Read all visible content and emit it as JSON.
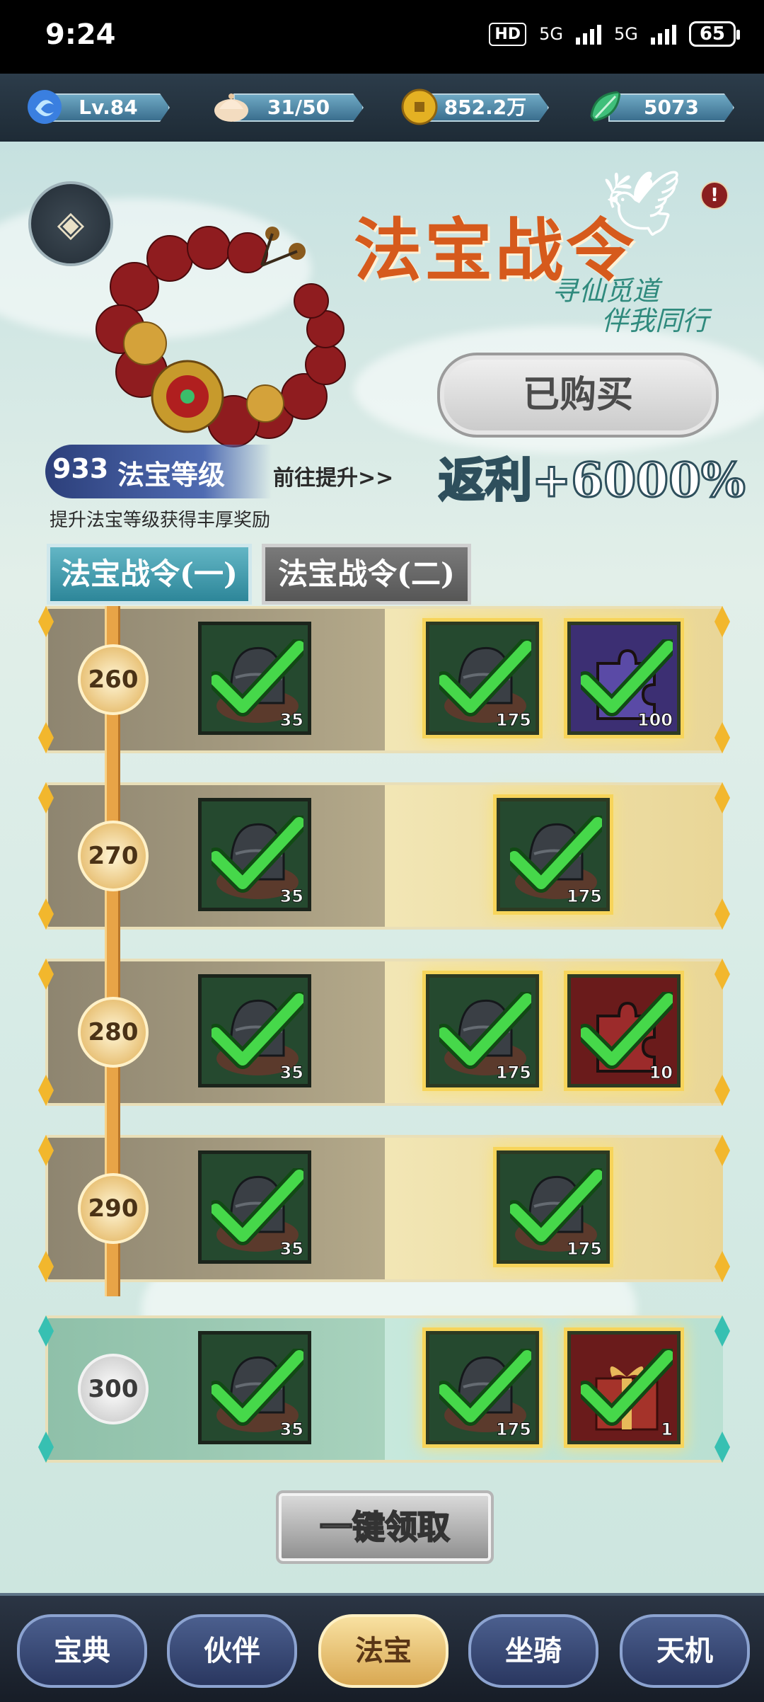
{
  "status": {
    "time": "9:24",
    "hd_label": "HD",
    "net1": "5G",
    "net2": "5G",
    "battery": "65"
  },
  "resources": {
    "level": "Lv.84",
    "stamina": "31/50",
    "coins": "852.2万",
    "jade": "5073"
  },
  "header": {
    "title": "法宝战令",
    "subtitle_line1": "寻仙觅道",
    "subtitle_line2": "伴我同行",
    "alert_icon_text": "!",
    "bought_label": "已购买",
    "rebate": "返利+6000%"
  },
  "treasure": {
    "level_num": "933",
    "level_label": "法宝等级",
    "goto_label": "前往提升>>",
    "hint": "提升法宝等级获得丰厚奖励"
  },
  "tabs": [
    {
      "label": "法宝战令(一)",
      "active": true
    },
    {
      "label": "法宝战令(二)",
      "active": false
    }
  ],
  "rows": [
    {
      "level": "260",
      "free": {
        "qty": "35"
      },
      "paid": [
        {
          "qty": "175",
          "kind": "hat"
        },
        {
          "qty": "100",
          "kind": "puzzle-purple"
        }
      ]
    },
    {
      "level": "270",
      "free": {
        "qty": "35"
      },
      "paid": [
        {
          "qty": "175",
          "kind": "hat"
        }
      ]
    },
    {
      "level": "280",
      "free": {
        "qty": "35"
      },
      "paid": [
        {
          "qty": "175",
          "kind": "hat"
        },
        {
          "qty": "10",
          "kind": "puzzle-red"
        }
      ]
    },
    {
      "level": "290",
      "free": {
        "qty": "35"
      },
      "paid": [
        {
          "qty": "175",
          "kind": "hat"
        }
      ]
    },
    {
      "level": "300",
      "free": {
        "qty": "35"
      },
      "paid": [
        {
          "qty": "175",
          "kind": "hat"
        },
        {
          "qty": "1",
          "kind": "gift-red"
        }
      ]
    }
  ],
  "claim_all": "一键领取",
  "nav": [
    {
      "label": "宝典",
      "active": false
    },
    {
      "label": "伙伴",
      "active": false
    },
    {
      "label": "法宝",
      "active": true
    },
    {
      "label": "坐骑",
      "active": false
    },
    {
      "label": "天机",
      "active": false
    }
  ],
  "colors": {
    "accent_orange": "#d65a1c",
    "gold": "#f2b72d",
    "teal": "#2d8699"
  }
}
